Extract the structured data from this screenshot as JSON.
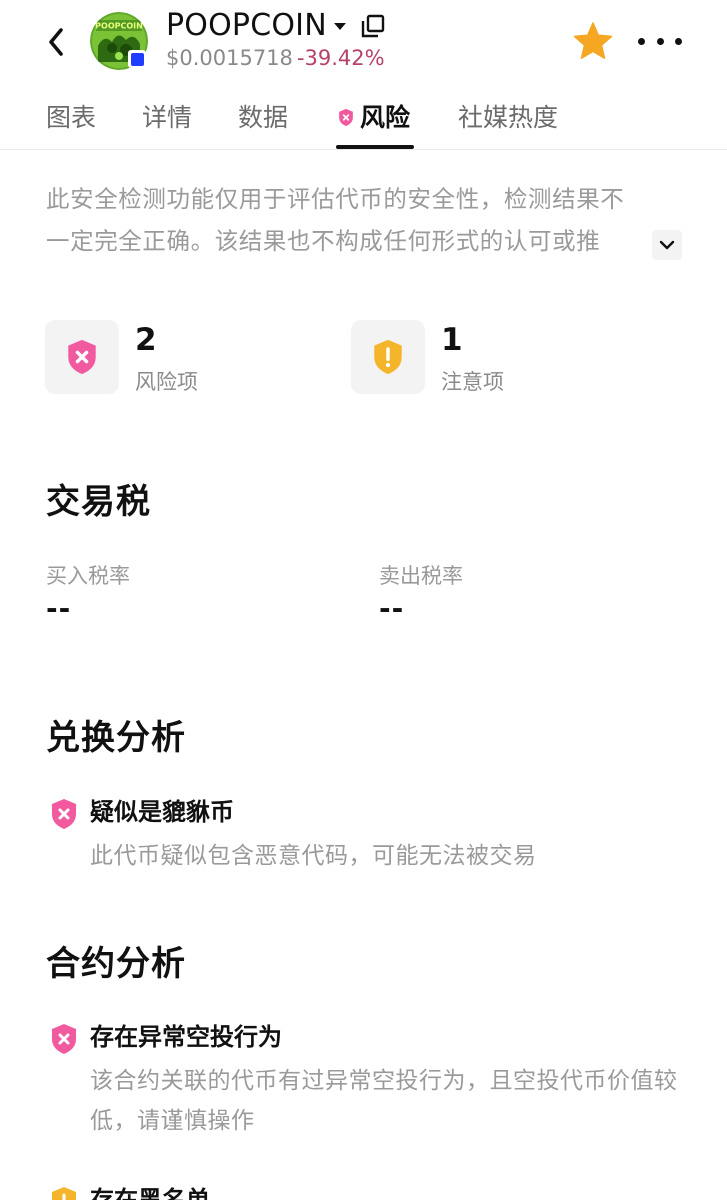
{
  "header": {
    "coin_name": "POOPCOIN",
    "avatar_text": "POOPCOIN",
    "price": "$0.0015718",
    "change": "-39.42%",
    "icons": {
      "back": "chevron-left-icon",
      "dropdown": "caret-down-icon",
      "copy": "copy-icon",
      "favorite": "star-icon",
      "more": "more-horizontal-icon"
    },
    "colors": {
      "change_negative": "#b6416a",
      "star": "#f5a623",
      "chain_badge": "#1f3cff"
    }
  },
  "tabs": [
    {
      "label": "图表"
    },
    {
      "label": "详情"
    },
    {
      "label": "数据"
    },
    {
      "label": "风险",
      "active": true,
      "icon": "shield-x-icon"
    },
    {
      "label": "社媒热度"
    }
  ],
  "disclaimer": {
    "line1": "此安全检测功能仅用于评估代币的安全性，检测结果不",
    "line2": "一定完全正确。该结果也不构成任何形式的认可或推"
  },
  "summary": {
    "risk": {
      "count": "2",
      "label": "风险项",
      "color": "#f25aa0"
    },
    "caution": {
      "count": "1",
      "label": "注意项",
      "color": "#f5b52a"
    }
  },
  "tax": {
    "title": "交易税",
    "buy_label": "买入税率",
    "buy_value": "--",
    "sell_label": "卖出税率",
    "sell_value": "--"
  },
  "swap_analysis": {
    "title": "兑换分析",
    "items": [
      {
        "title": "疑似是貔貅币",
        "desc": "此代币疑似包含恶意代码，可能无法被交易"
      }
    ]
  },
  "contract_analysis": {
    "title": "合约分析",
    "items": [
      {
        "title": "存在异常空投行为",
        "desc": "该合约关联的代币有过异常空投行为，且空投代币价值较低，请谨慎操作"
      },
      {
        "title": "存在黑名单"
      }
    ]
  }
}
